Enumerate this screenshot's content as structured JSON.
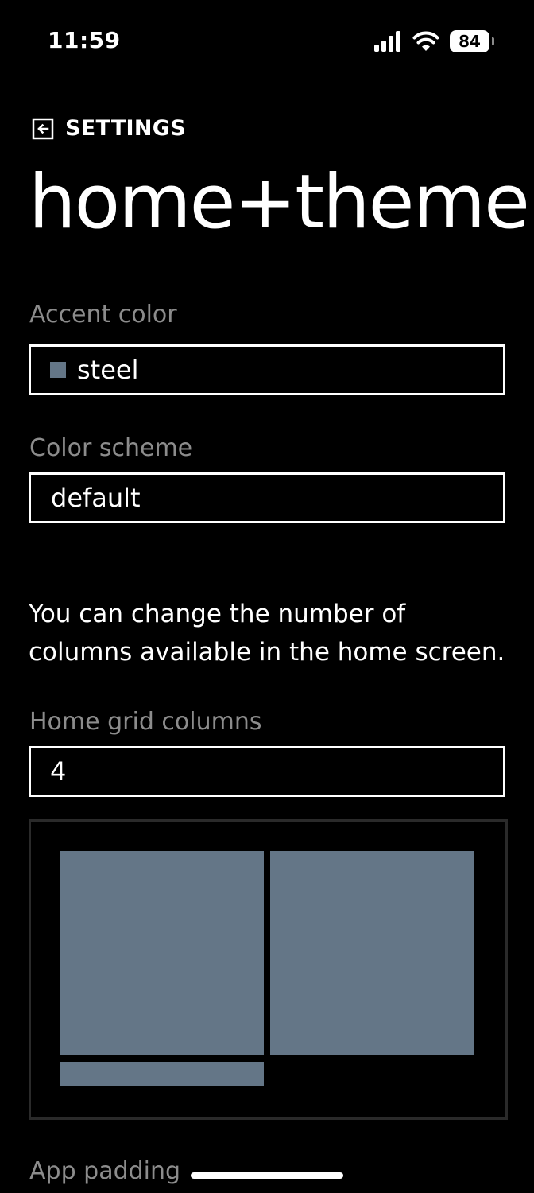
{
  "status_bar": {
    "time": "11:59",
    "battery": "84",
    "icons": [
      "signal-icon",
      "wifi-icon",
      "battery-icon"
    ]
  },
  "header": {
    "back_label": "SETTINGS",
    "back_icon": "back-arrow-icon",
    "title": "home+theme"
  },
  "accent": {
    "label": "Accent color",
    "value": "steel",
    "color": "#647687"
  },
  "scheme": {
    "label": "Color scheme",
    "value": "default"
  },
  "description": "You can change the number of columns available in the home screen.",
  "grid": {
    "label": "Home grid columns",
    "value": "4"
  },
  "padding": {
    "label": "App padding"
  },
  "colors": {
    "background": "#000000",
    "text": "#ffffff",
    "label": "#8c8c8c",
    "tile": "#647687",
    "preview_border": "#2a2a2a"
  }
}
